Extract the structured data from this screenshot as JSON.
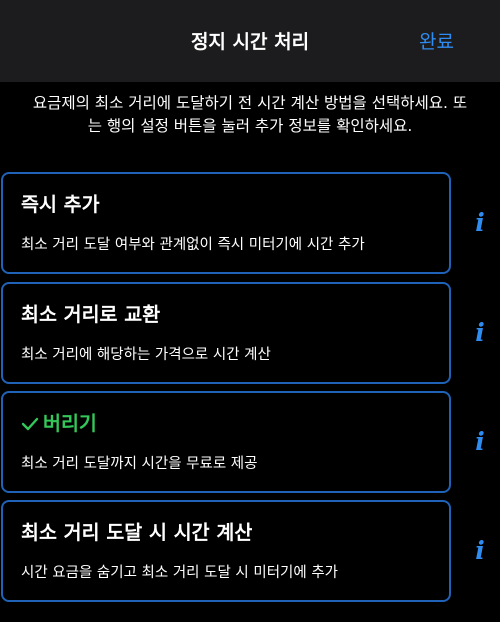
{
  "nav": {
    "title": "정지 시간 처리",
    "done_label": "완료"
  },
  "description": "요금제의 최소 거리에 도달하기 전 시간 계산 방법을 선택하세요. 또는 행의 설정 버튼을 눌러 추가 정보를 확인하세요.",
  "options": [
    {
      "title": "즉시 추가",
      "subtitle": "최소 거리 도달 여부와 관계없이 즉시 미터기에 시간 추가",
      "selected": false
    },
    {
      "title": "최소 거리로 교환",
      "subtitle": "최소 거리에 해당하는 가격으로 시간 계산",
      "selected": false
    },
    {
      "title": "버리기",
      "subtitle": "최소 거리 도달까지 시간을 무료로 제공",
      "selected": true
    },
    {
      "title": "최소 거리 도달 시 시간 계산",
      "subtitle": "시간 요금을 숨기고 최소 거리 도달 시 미터기에 추가",
      "selected": false
    }
  ],
  "info_glyph": "i",
  "icons": {
    "selected_marker": "checkmark-icon",
    "row_action": "info-icon"
  },
  "colors": {
    "accent": "#2f8cf0",
    "selected": "#34c759",
    "card_border": "#1f62b8",
    "navbar": "#1c1c1e",
    "background": "#000000"
  }
}
